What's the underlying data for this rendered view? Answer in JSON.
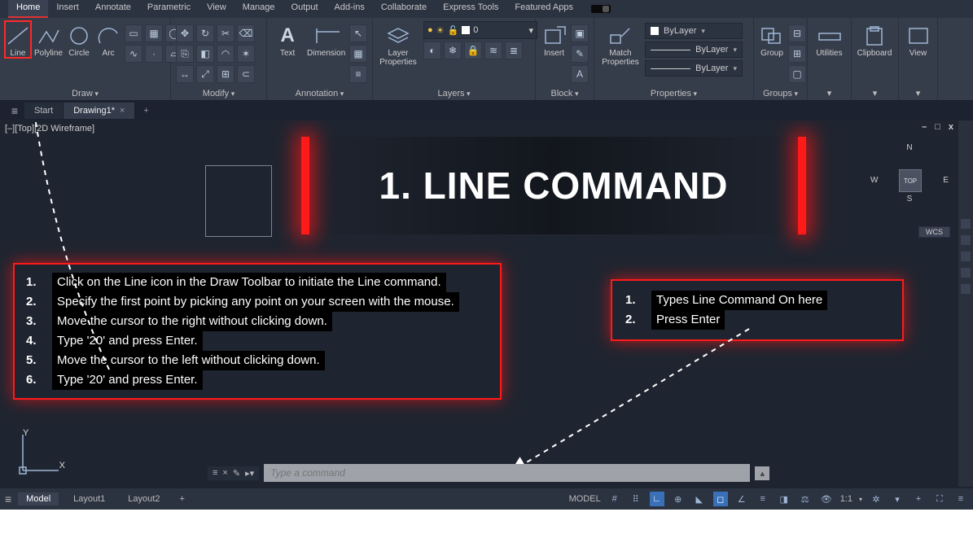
{
  "menu": {
    "tabs": [
      "Home",
      "Insert",
      "Annotate",
      "Parametric",
      "View",
      "Manage",
      "Output",
      "Add-ins",
      "Collaborate",
      "Express Tools",
      "Featured Apps"
    ],
    "active": "Home"
  },
  "ribbon": {
    "draw": {
      "title": "Draw",
      "line": "Line",
      "polyline": "Polyline",
      "circle": "Circle",
      "arc": "Arc"
    },
    "modify": {
      "title": "Modify"
    },
    "annotation": {
      "title": "Annotation",
      "text": "Text",
      "dimension": "Dimension"
    },
    "layers": {
      "title": "Layers",
      "btn": "Layer\nProperties",
      "current": "0"
    },
    "block": {
      "title": "Block",
      "insert": "Insert"
    },
    "properties": {
      "title": "Properties",
      "match": "Match\nProperties",
      "bylayer": "ByLayer",
      "line1": "ByLayer",
      "line2": "ByLayer"
    },
    "groups": {
      "title": "Groups",
      "group": "Group"
    },
    "utilities": {
      "title": "Utilities"
    },
    "clipboard": {
      "title": "Clipboard"
    },
    "view": {
      "title": "View"
    }
  },
  "filetabs": {
    "start": "Start",
    "drawing": "Drawing1*"
  },
  "canvas": {
    "viewlabel": "[–][Top][2D Wireframe]",
    "cube_top": "TOP",
    "wcs": "WCS",
    "n": "N",
    "s": "S",
    "e": "E",
    "w": "W",
    "y": "Y",
    "x": "X"
  },
  "overlay": {
    "title": "1. LINE COMMAND",
    "steps": [
      "Click on the Line icon in the Draw Toolbar to initiate the Line command.",
      "Specify the first point by picking any point on your screen with the mouse.",
      "Move the cursor to the right without clicking down.",
      "Type '20' and press Enter.",
      "Move the cursor to the left without clicking down.",
      "Type '20' and press Enter."
    ],
    "side": [
      "Types Line Command On here",
      "Press Enter"
    ]
  },
  "cmd": {
    "placeholder": "Type a command"
  },
  "status": {
    "model": "Model",
    "layout1": "Layout1",
    "layout2": "Layout2",
    "model_btn": "MODEL",
    "scale": "1:1"
  },
  "winctl": {
    "min": "–",
    "max": "□",
    "close": "x"
  }
}
